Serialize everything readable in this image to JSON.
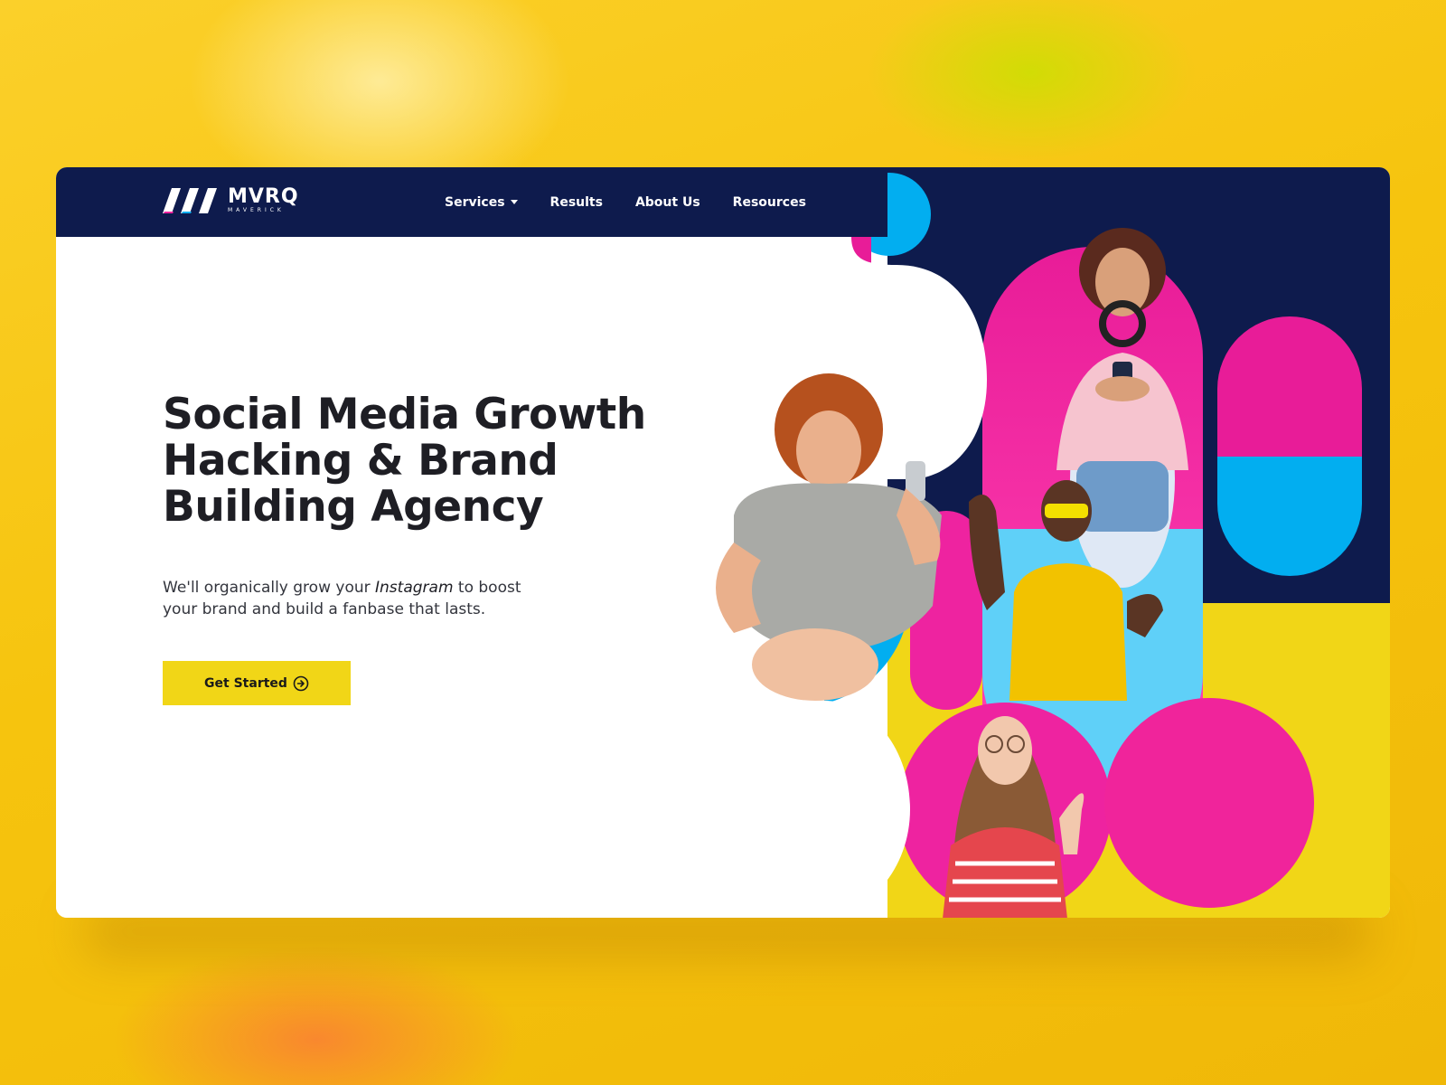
{
  "brand": {
    "name": "MVRQ",
    "tagline": "MAVERICK"
  },
  "nav": {
    "items": [
      {
        "label": "Services",
        "has_dropdown": true
      },
      {
        "label": "Results",
        "has_dropdown": false
      },
      {
        "label": "About Us",
        "has_dropdown": false
      },
      {
        "label": "Resources",
        "has_dropdown": false
      }
    ]
  },
  "hero": {
    "headline_lines": [
      "Social Media Growth",
      "Hacking & Brand",
      "Building Agency"
    ],
    "subtext_before": "We'll organically grow your ",
    "subtext_emphasis": "Instagram",
    "subtext_after": " to boost your brand and build a fanbase that lasts.",
    "cta_label": "Get Started",
    "cta_icon": "arrow-circle-right-icon"
  },
  "colors": {
    "navy": "#0e1b4d",
    "magenta": "#f0249b",
    "sky": "#02aef0",
    "yellow": "#f1d617",
    "background": "#f6c40e"
  }
}
